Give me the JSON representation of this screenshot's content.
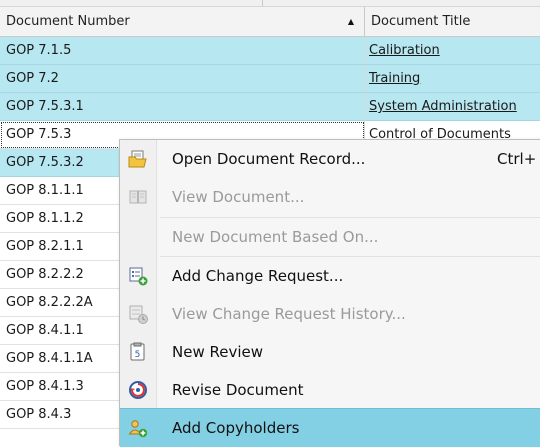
{
  "grid": {
    "columns": [
      {
        "label": "Document Number",
        "sort": "ascending"
      },
      {
        "label": "Document Title"
      }
    ],
    "rows": [
      {
        "number": "GOP 7.1.5",
        "title": "Calibration"
      },
      {
        "number": "GOP 7.2",
        "title": "Training"
      },
      {
        "number": "GOP 7.5.3.1",
        "title": "System Administration"
      },
      {
        "number": "GOP 7.5.3",
        "title": "Control of Documents"
      },
      {
        "number": "GOP 7.5.3.2",
        "title": ""
      },
      {
        "number": "GOP 8.1.1.1",
        "title": ""
      },
      {
        "number": "GOP 8.1.1.2",
        "title": ""
      },
      {
        "number": "GOP 8.2.1.1",
        "title": ""
      },
      {
        "number": "GOP 8.2.2.2",
        "title": ""
      },
      {
        "number": "GOP 8.2.2.2A",
        "title": ""
      },
      {
        "number": "GOP 8.4.1.1",
        "title": ""
      },
      {
        "number": "GOP 8.4.1.1A",
        "title": ""
      },
      {
        "number": "GOP 8.4.1.3",
        "title": ""
      },
      {
        "number": "GOP 8.4.3",
        "title": ""
      }
    ]
  },
  "context_menu": {
    "items": [
      {
        "label": "Open Document Record...",
        "shortcut": "Ctrl+",
        "icon": "folder-open-icon",
        "enabled": true
      },
      {
        "label": "View Document...",
        "icon": "book-icon",
        "enabled": false
      },
      {
        "label": "New Document Based On...",
        "enabled": false
      },
      {
        "label": "Add Change Request...",
        "icon": "add-change-request-icon",
        "enabled": true
      },
      {
        "label": "View Change Request History...",
        "icon": "change-history-icon",
        "enabled": false
      },
      {
        "label": "New Review",
        "icon": "review-icon",
        "enabled": true
      },
      {
        "label": "Revise Document",
        "icon": "revise-icon",
        "enabled": true
      },
      {
        "label": "Add Copyholders",
        "icon": "add-users-icon",
        "enabled": true,
        "highlighted": true
      }
    ]
  },
  "colors": {
    "selection": "#b7e8f2",
    "menu_highlight": "#83d0e4"
  }
}
